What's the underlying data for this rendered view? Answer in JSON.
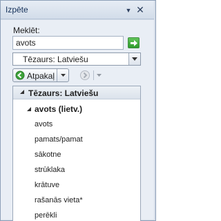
{
  "pane": {
    "title": "Izpēte"
  },
  "search": {
    "label": "Meklēt:",
    "value": "avots"
  },
  "source": {
    "selected": "Tēzaurs: Latviešu"
  },
  "navigation": {
    "back_label": "Atpakaļ"
  },
  "results": {
    "header": "Tēzaurs: Latviešu",
    "group": "avots (lietv.)",
    "synonyms": [
      "avots",
      "pamats/pamat",
      "sākotne",
      "strūklaka",
      "krātuve",
      "rašanās vieta*",
      "perēkli"
    ]
  }
}
